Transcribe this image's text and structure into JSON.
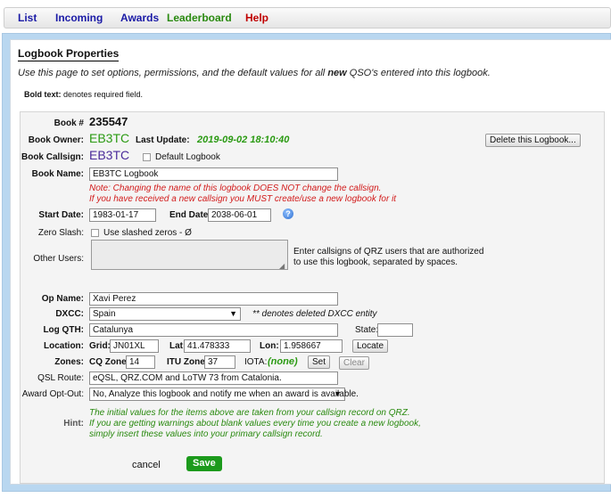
{
  "nav": {
    "list": "List",
    "incoming": "Incoming",
    "awards": "Awards",
    "leaderboard": "Leaderboard",
    "help": "Help"
  },
  "header": {
    "title": "Logbook Properties",
    "intro_before": "Use this page to set options, permissions, and the default values for all ",
    "intro_bold": "new",
    "intro_after": " QSO's entered into this logbook.",
    "bold_label": "Bold text:",
    "bold_desc": " denotes required field."
  },
  "book": {
    "number_label": "Book #",
    "number": "235547",
    "owner_label": "Book Owner:",
    "owner": "EB3TC",
    "last_update_label": "Last Update:",
    "last_update": "2019-09-02 18:10:40",
    "delete_button": "Delete this Logbook...",
    "callsign_label": "Book Callsign:",
    "callsign": "EB3TC",
    "default_logbook_label": "Default Logbook",
    "name_label": "Book Name:",
    "name_value": "EB3TC Logbook",
    "note_line1": "Note: Changing the name of this logbook DOES NOT change the callsign.",
    "note_line2": "If you have received a new callsign you MUST create/use a new logbook for it",
    "start_label": "Start Date:",
    "start_value": "1983-01-17",
    "end_label": "End Date:",
    "end_value": "2038-06-01",
    "zero_slash_label": "Zero Slash:",
    "zero_slash_option": "Use slashed zeros - Ø",
    "other_users_label": "Other Users:",
    "other_users_value": "",
    "other_users_desc1": "Enter callsigns of QRZ users that are authorized",
    "other_users_desc2": "to use this logbook, separated by spaces."
  },
  "defaults": {
    "op_name_label": "Op Name:",
    "op_name": "Xavi Perez",
    "dxcc_label": "DXCC:",
    "dxcc": "Spain",
    "dxcc_note": "** denotes deleted DXCC entity",
    "qth_label": "Log QTH:",
    "qth": "Catalunya",
    "state_label": "State:",
    "state": "",
    "location_label": "Location:",
    "grid_label": "Grid:",
    "grid": "JN01XL",
    "lat_label": "Lat:",
    "lat": "41.478333",
    "lon_label": "Lon:",
    "lon": "1.958667",
    "locate_button": "Locate",
    "zones_label": "Zones:",
    "cq_label": "CQ Zone:",
    "cq": "14",
    "itu_label": "ITU Zone:",
    "itu": "37",
    "iota_label": "IOTA:",
    "iota": "(none)",
    "set_button": "Set",
    "clear_button": "Clear",
    "qsl_label": "QSL Route:",
    "qsl": "eQSL, QRZ.COM and LoTW 73 from Catalonia.",
    "award_label": "Award Opt-Out:",
    "award": "No, Analyze this logbook and notify me when an award is available."
  },
  "hint": {
    "label": "Hint:",
    "line1": "The initial values for the items above are taken from your callsign record on QRZ.",
    "line2": "If you are getting warnings about blank values every time you create a new logbook,",
    "line3": "simply insert these values into your primary callsign record."
  },
  "actions": {
    "cancel": "cancel",
    "save": "Save"
  },
  "colors": {
    "nav_blue": "#1a1aa6",
    "nav_green": "#2a8a10",
    "nav_red": "#c00000",
    "callsign_green": "#2a9a12",
    "owner_purple": "#4a2a9a",
    "note_red": "#d21b1b",
    "save_green": "#1c9a1c",
    "frame_blue": "#b9d7f0"
  }
}
